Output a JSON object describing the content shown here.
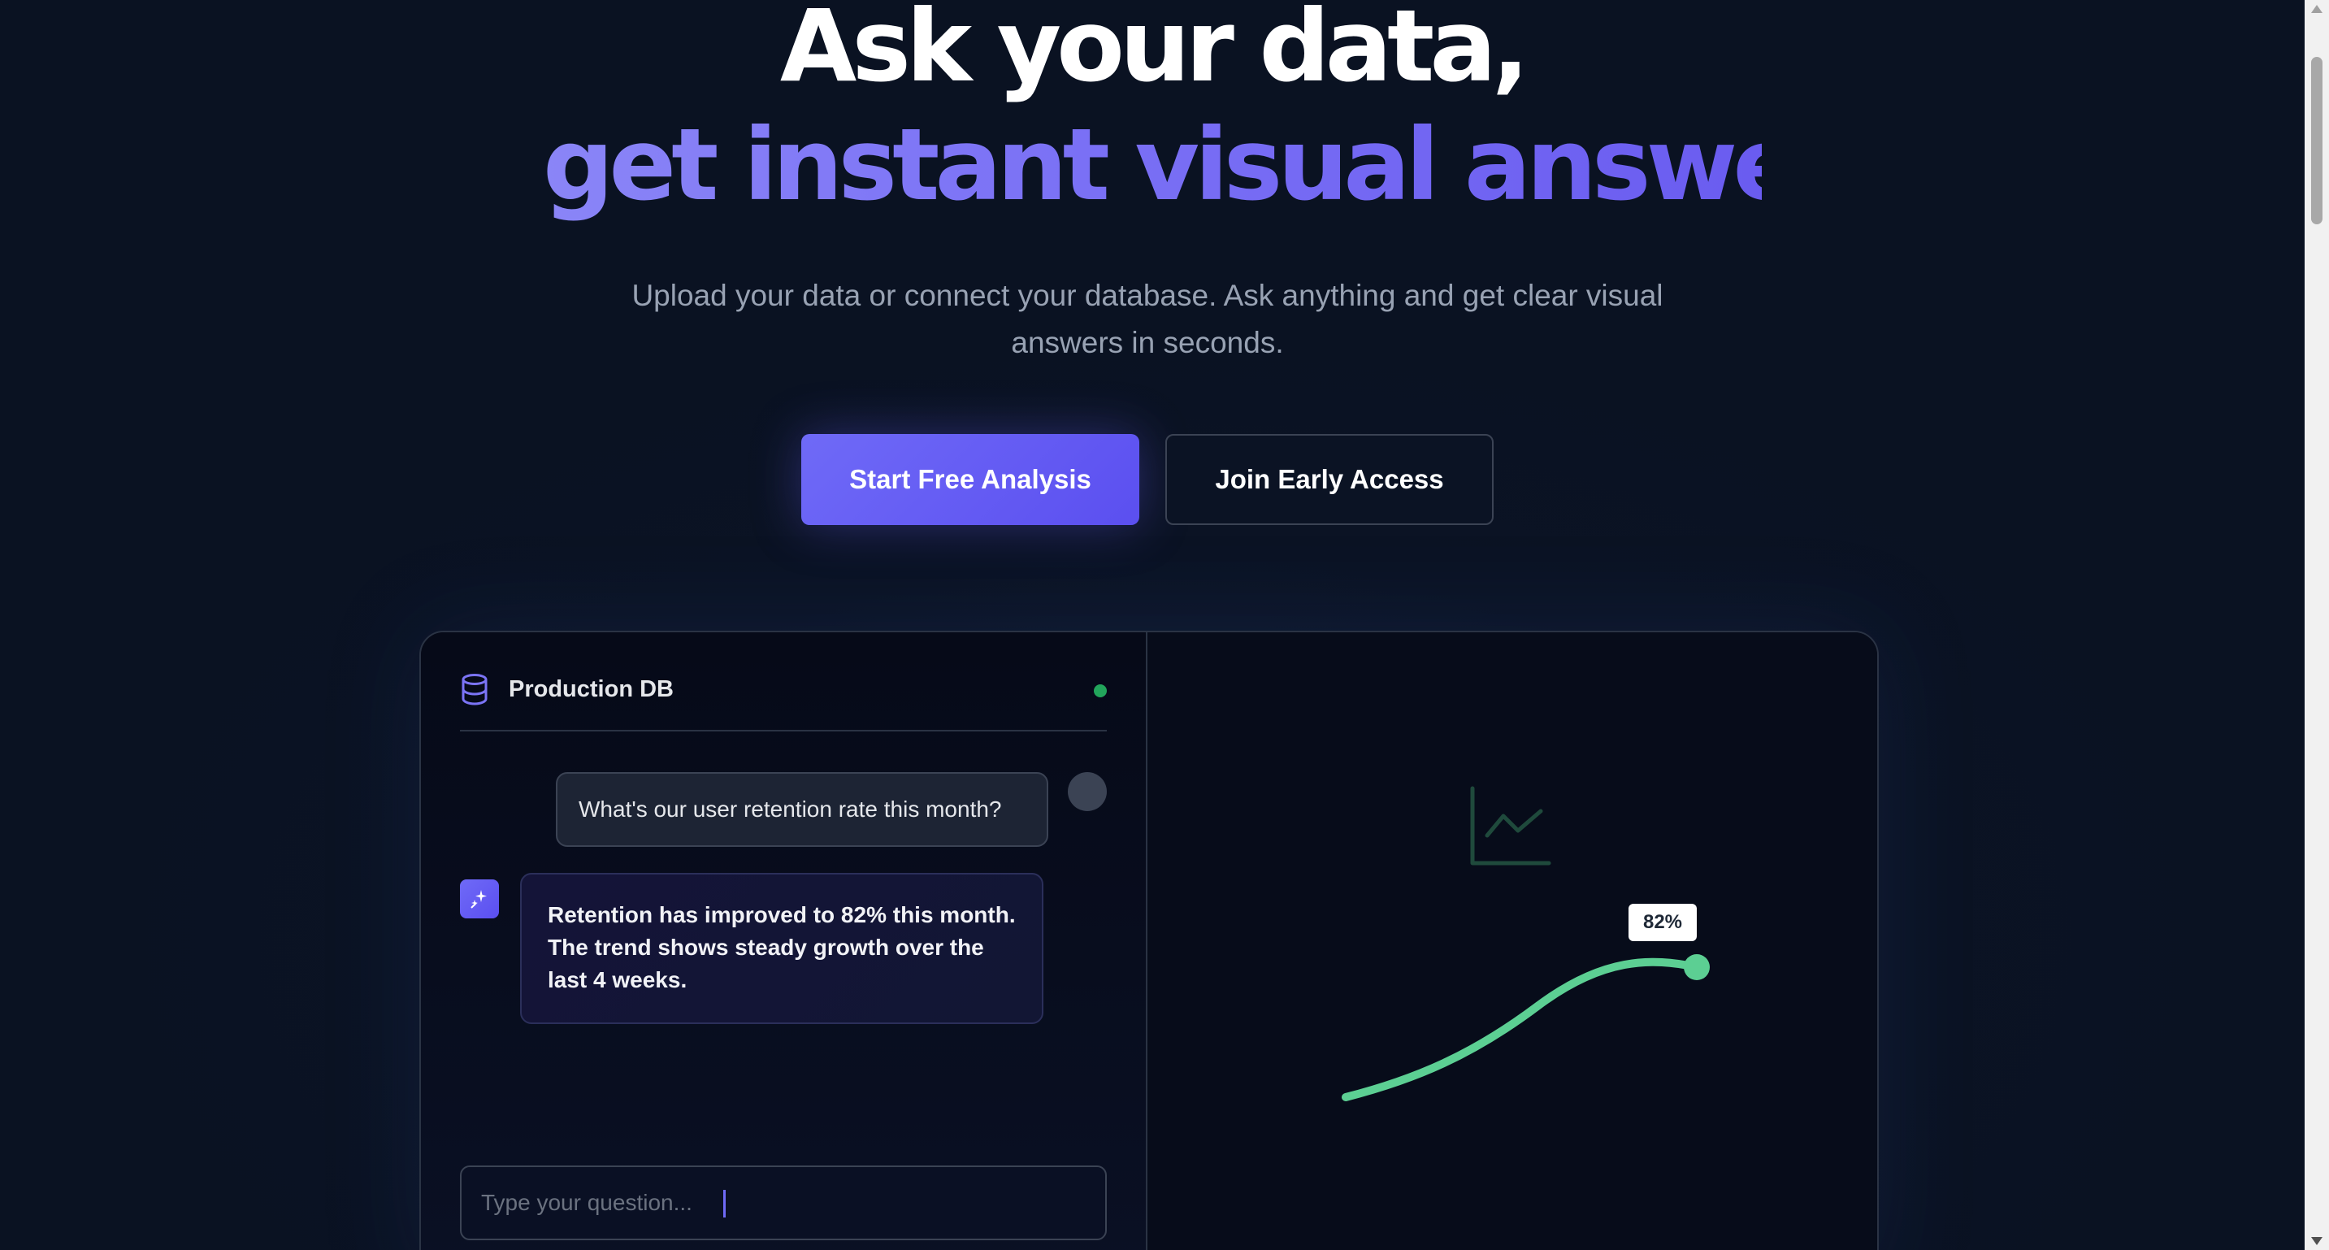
{
  "hero": {
    "headline_line1": "Ask your data,",
    "headline_line2": "get instant visual answers.",
    "subtitle_line1": "Upload your data or connect your database. Ask anything and get clear visual",
    "subtitle_line2": "answers in seconds."
  },
  "buttons": {
    "primary_label": "Start Free Analysis",
    "secondary_label": "Join Early Access"
  },
  "demo": {
    "db_label": "Production DB",
    "db_icon": "database-icon",
    "status_color": "#22a55b",
    "user_message": "What's our user retention rate this month?",
    "ai_icon": "sparkle-icon",
    "ai_message": "Retention has improved to 82% this month. The trend shows steady growth over the last 4 weeks.",
    "input_placeholder": "Type your question...",
    "chart_icon": "line-chart-icon",
    "chart_value_label": "82%",
    "accent_color": "#6f6af7",
    "chart_color": "#5ccf93"
  }
}
